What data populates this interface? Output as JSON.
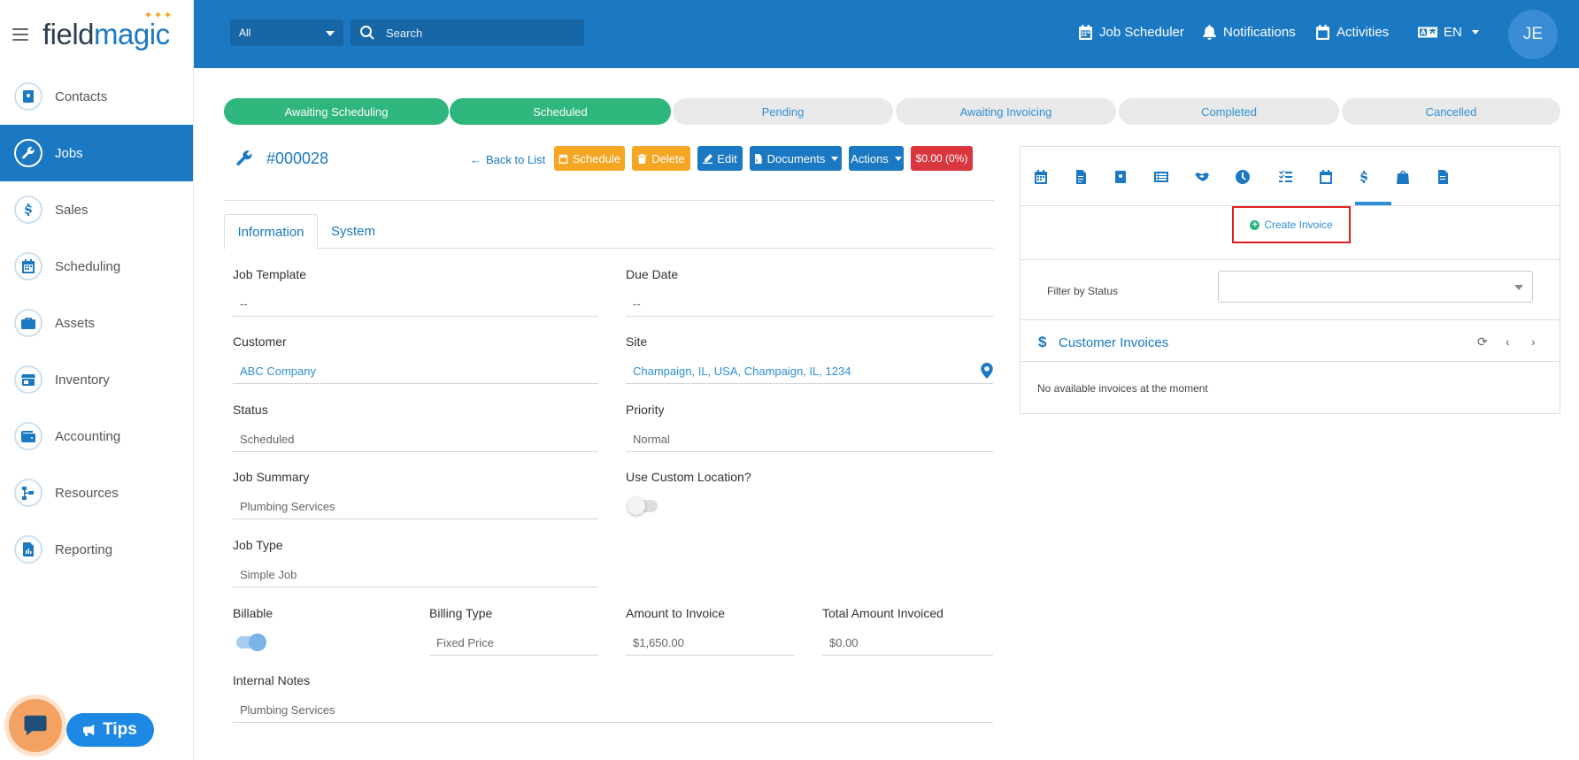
{
  "app": {
    "logo_part1": "field",
    "logo_part2": "magic",
    "logo_sparkles": "✦✦✦"
  },
  "sidebar": {
    "items": [
      {
        "label": "Contacts",
        "icon": "contact-card-icon"
      },
      {
        "label": "Jobs",
        "icon": "wrench-icon"
      },
      {
        "label": "Sales",
        "icon": "dollar-icon"
      },
      {
        "label": "Scheduling",
        "icon": "calendar-icon"
      },
      {
        "label": "Assets",
        "icon": "briefcase-icon"
      },
      {
        "label": "Inventory",
        "icon": "store-icon"
      },
      {
        "label": "Accounting",
        "icon": "wallet-icon"
      },
      {
        "label": "Resources",
        "icon": "network-icon"
      },
      {
        "label": "Reporting",
        "icon": "report-icon"
      }
    ],
    "active": "Jobs"
  },
  "tips": {
    "label": "Tips"
  },
  "topbar": {
    "scope_value": "All",
    "search_placeholder": "Search",
    "job_scheduler": "Job Scheduler",
    "notifications": "Notifications",
    "activities": "Activities",
    "language": "EN",
    "avatar_initials": "JE"
  },
  "progress": {
    "steps": [
      "Awaiting Scheduling",
      "Scheduled",
      "Pending",
      "Awaiting Invoicing",
      "Completed",
      "Cancelled"
    ],
    "completed_count": 2
  },
  "job": {
    "number": "#000028",
    "back_label": "Back to List",
    "schedule_label": "Schedule",
    "delete_label": "Delete",
    "edit_label": "Edit",
    "documents_label": "Documents",
    "actions_label": "Actions",
    "amount_badge": "$0.00 (0%)"
  },
  "tabs": [
    "Information",
    "System"
  ],
  "form": {
    "job_template": {
      "label": "Job Template",
      "value": "--"
    },
    "due_date": {
      "label": "Due Date",
      "value": "--"
    },
    "customer": {
      "label": "Customer",
      "value": "ABC Company"
    },
    "site": {
      "label": "Site",
      "value": "Champaign, IL, USA, Champaign, IL, 1234"
    },
    "status": {
      "label": "Status",
      "value": "Scheduled"
    },
    "priority": {
      "label": "Priority",
      "value": "Normal"
    },
    "job_summary": {
      "label": "Job Summary",
      "value": "Plumbing Services"
    },
    "custom_location": {
      "label": "Use Custom Location?",
      "on": false
    },
    "job_type": {
      "label": "Job Type",
      "value": "Simple Job"
    },
    "billable": {
      "label": "Billable",
      "on": true
    },
    "billing_type": {
      "label": "Billing Type",
      "value": "Fixed Price"
    },
    "amount_to_invoice": {
      "label": "Amount to Invoice",
      "value": "$1,650.00"
    },
    "total_invoiced": {
      "label": "Total Amount Invoiced",
      "value": "$0.00"
    },
    "internal_notes": {
      "label": "Internal Notes",
      "value": "Plumbing Services"
    }
  },
  "panel": {
    "icon_tabs": [
      "calendar-icon",
      "document-icon",
      "contact-card-icon",
      "list-icon",
      "handshake-icon",
      "clock-icon",
      "checklist-icon",
      "calendar-alt-icon",
      "dollar-icon",
      "shopping-bag-icon",
      "file-icon"
    ],
    "active_icon_tab": "dollar-icon",
    "create_invoice": "Create Invoice",
    "filter_label": "Filter by Status",
    "filter_value": "",
    "invoices_title": "Customer Invoices",
    "invoices_empty": "No available invoices at the moment"
  },
  "colors": {
    "brand": "#1b78c2",
    "success": "#2eb67d",
    "warning": "#f5a623",
    "danger": "#d9363e"
  }
}
